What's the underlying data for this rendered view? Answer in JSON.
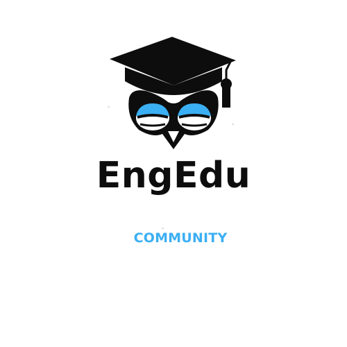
{
  "brand": {
    "name": "EngEdu",
    "tagline": "COMMUNITY",
    "logo_icon": "graduation-owl-icon"
  },
  "colors": {
    "ink": "#0d0d0d",
    "accent": "#3baff3",
    "background": "#ffffff"
  }
}
